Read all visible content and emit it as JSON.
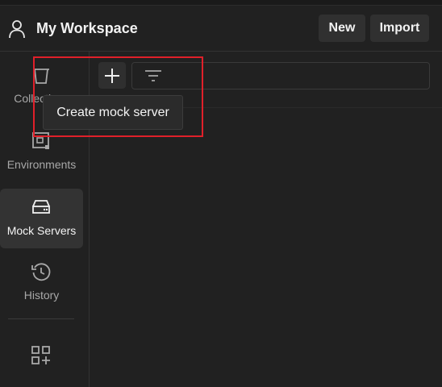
{
  "header": {
    "workspace_title": "My Workspace",
    "new_label": "New",
    "import_label": "Import",
    "workspace_icon": "user-icon"
  },
  "sidebar": {
    "items": [
      {
        "label": "Collections",
        "icon": "trash-can-icon",
        "active": false
      },
      {
        "label": "Environments",
        "icon": "environment-icon",
        "active": false
      },
      {
        "label": "Mock Servers",
        "icon": "server-icon",
        "active": true
      },
      {
        "label": "History",
        "icon": "history-icon",
        "active": false
      }
    ],
    "extra_icon": "add-apps-icon"
  },
  "toolbar": {
    "add_icon": "plus-icon",
    "filter_icon": "filter-icon",
    "tooltip": "Create mock server"
  },
  "colors": {
    "background": "#212121",
    "active_item": "#333333",
    "highlight": "#e0202a"
  }
}
